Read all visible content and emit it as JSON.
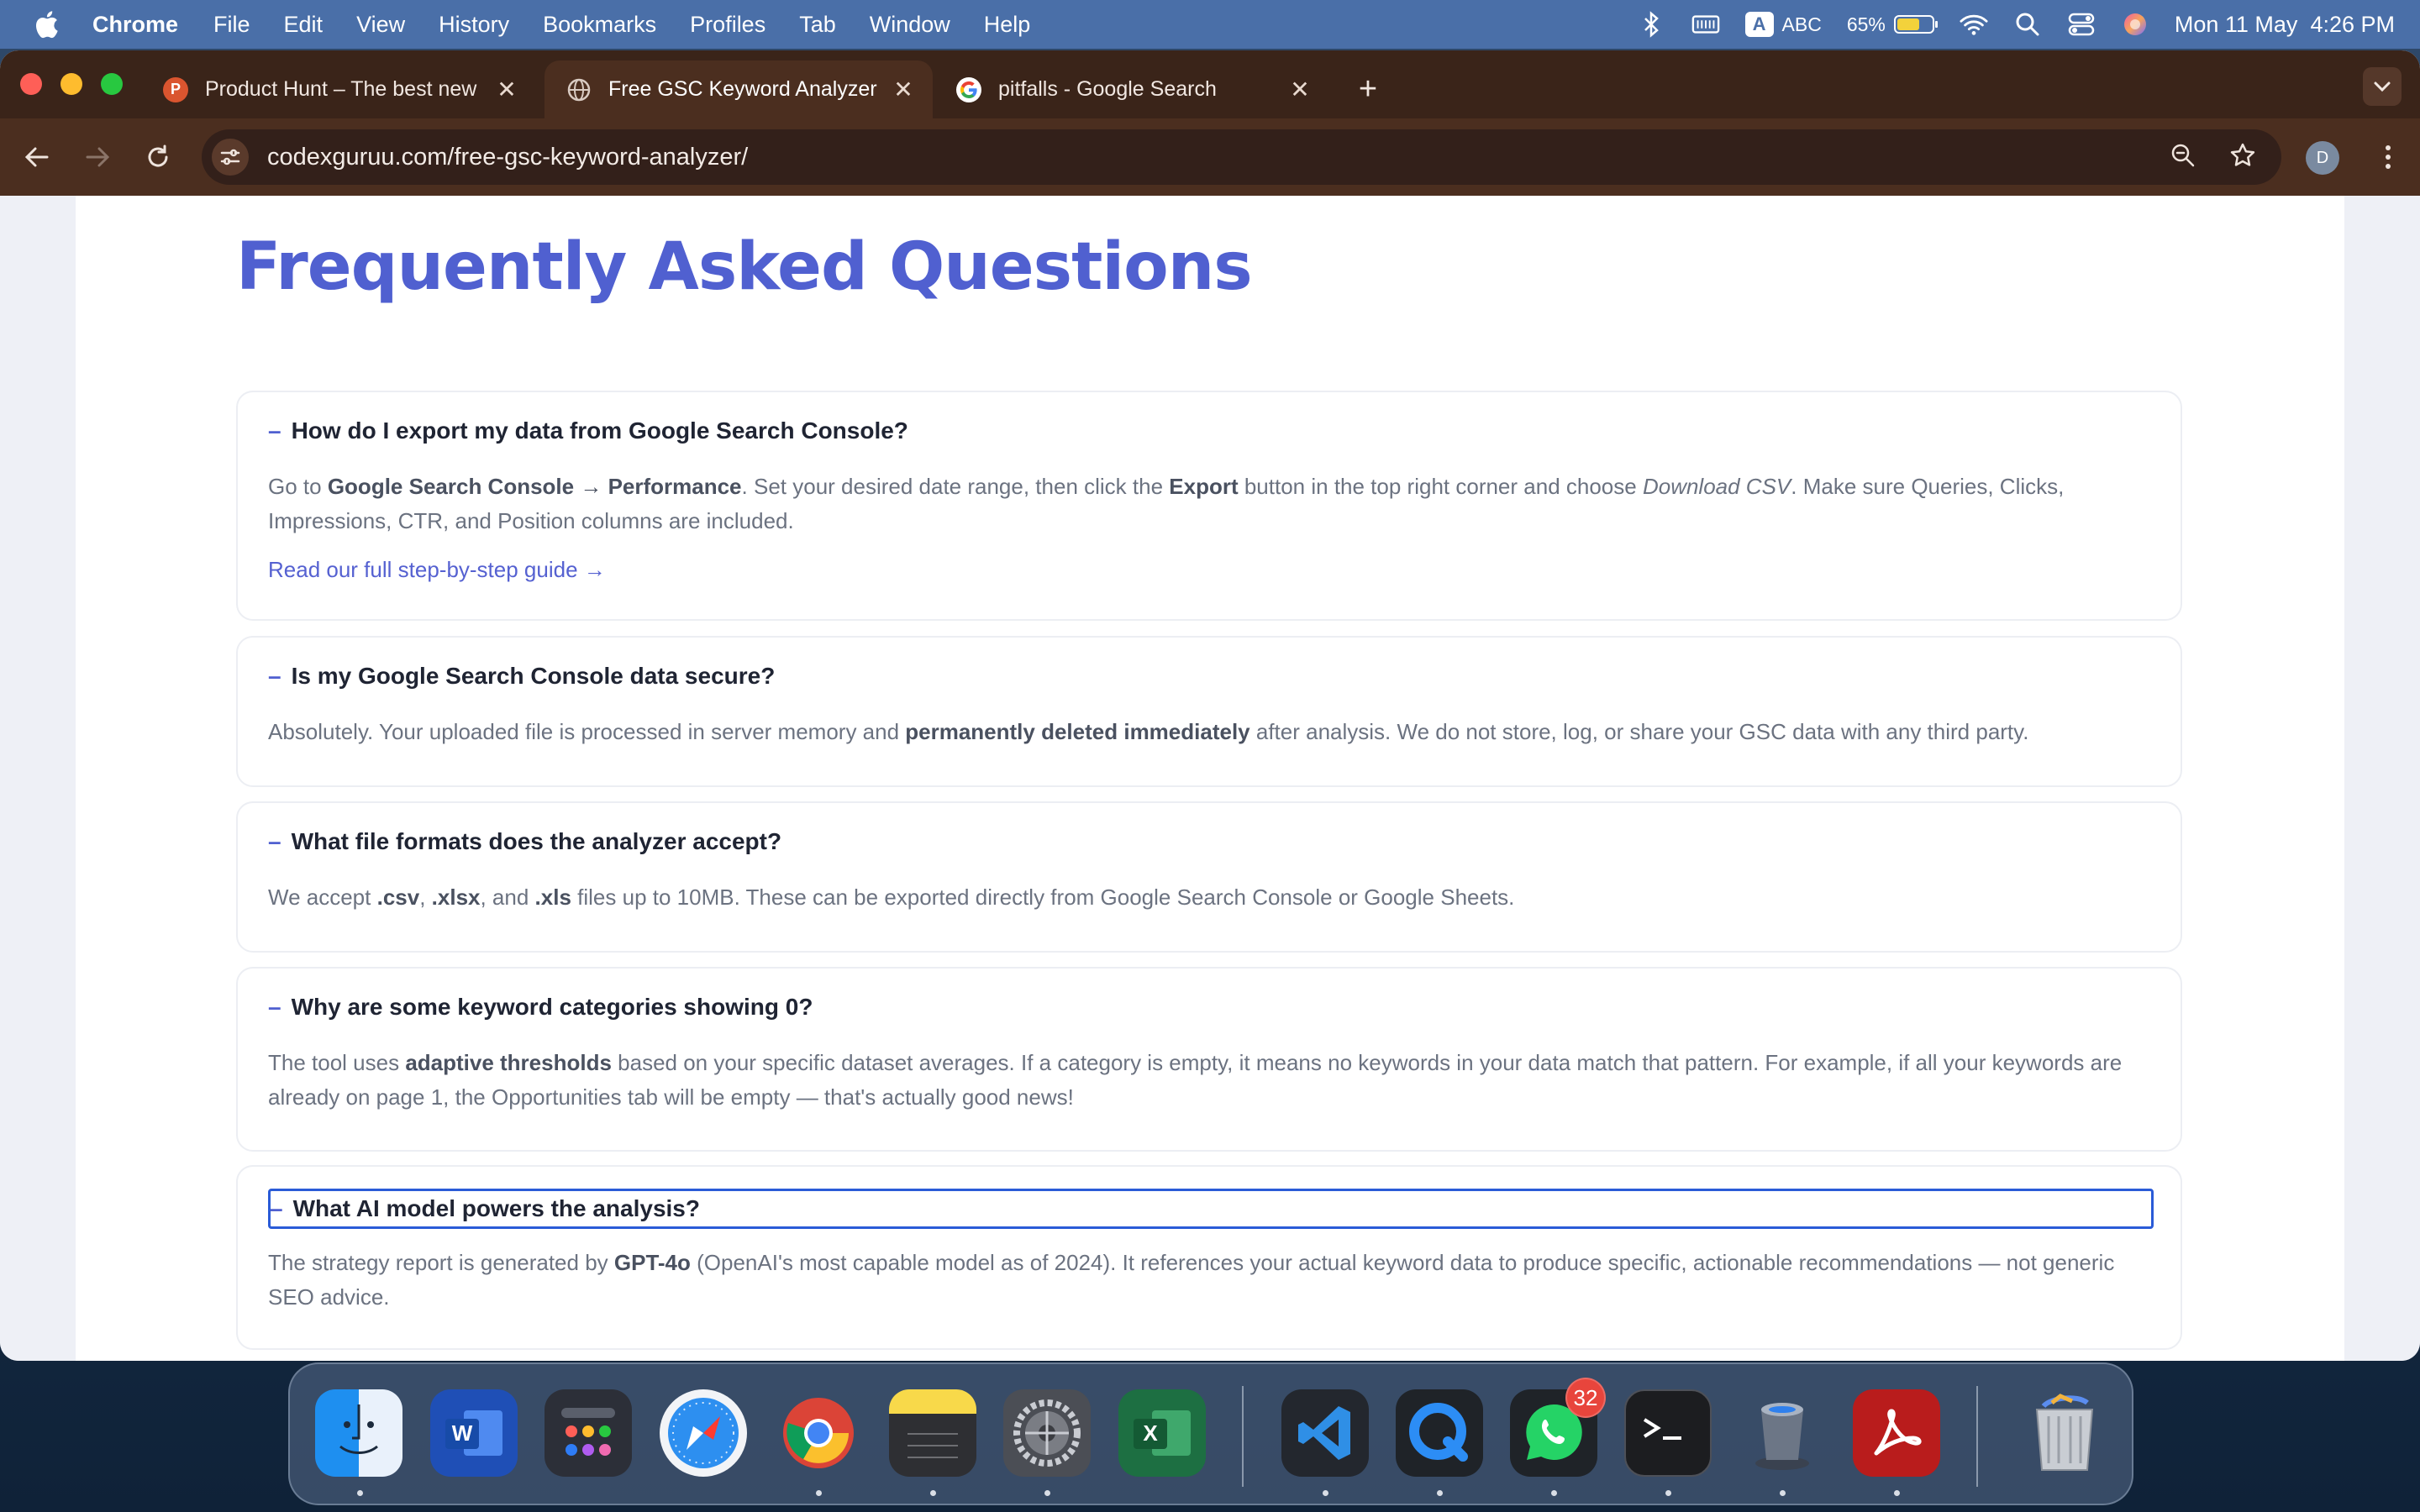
{
  "menubar": {
    "app_name": "Chrome",
    "items": [
      "File",
      "Edit",
      "View",
      "History",
      "Bookmarks",
      "Profiles",
      "Tab",
      "Window",
      "Help"
    ],
    "input_source": "A",
    "input_label": "ABC",
    "battery_percent": "65%",
    "battery_level": 0.65,
    "datetime": "Mon 11 May  4:26 PM"
  },
  "browser": {
    "tabs": [
      {
        "title": "Product Hunt – The best new products in tech.",
        "favicon": "P",
        "favicon_color": "#da552f",
        "active": false
      },
      {
        "title": "Free GSC Keyword Analyzer | CodexGuruu",
        "favicon": "globe-icon",
        "active": true
      },
      {
        "title": "pitfalls - Google Search",
        "favicon": "google-icon",
        "active": false
      }
    ],
    "url": "codexguruu.com/free-gsc-keyword-analyzer/",
    "profile_initial": "D"
  },
  "faq": {
    "title": "Frequently Asked Questions",
    "dash": "–",
    "items": [
      {
        "question": "How do I export my data from Google Search Console?",
        "answer_parts": {
          "p1": "Go to ",
          "b1": "Google Search Console → Performance",
          "p2": ". Set your desired date range, then click the ",
          "b2": "Export",
          "p3": " button in the top right corner and choose ",
          "i1": "Download CSV",
          "p4": ". Make sure Queries, Clicks, Impressions, CTR, and Position columns are included."
        },
        "link": "Read our full step-by-step guide →"
      },
      {
        "question": "Is my Google Search Console data secure?",
        "answer_parts": {
          "p1": "Absolutely. Your uploaded file is processed in server memory and ",
          "b1": "permanently deleted immediately",
          "p2": " after analysis. We do not store, log, or share your GSC data with any third party."
        }
      },
      {
        "question": "What file formats does the analyzer accept?",
        "answer_parts": {
          "p1": "We accept ",
          "b1": ".csv",
          "p2": ", ",
          "b2": ".xlsx",
          "p3": ", and ",
          "b3": ".xls",
          "p4": " files up to 10MB. These can be exported directly from Google Search Console or Google Sheets."
        }
      },
      {
        "question": "Why are some keyword categories showing 0?",
        "answer_parts": {
          "p1": "The tool uses ",
          "b1": "adaptive thresholds",
          "p2": " based on your specific dataset averages. If a category is empty, it means no keywords in your data match that pattern. For example, if all your keywords are already on page 1, the Opportunities tab will be empty — that's actually good news!"
        }
      },
      {
        "question": "What AI model powers the analysis?",
        "answer_parts": {
          "p1": "The strategy report is generated by ",
          "b1": "GPT-4o",
          "p2": " (OpenAI's most capable model as of 2024). It references your actual keyword data to produce specific, actionable recommendations — not generic SEO advice."
        }
      }
    ]
  },
  "dock": {
    "apps": [
      "Finder",
      "Microsoft Word",
      "Launchpad",
      "Safari",
      "Google Chrome",
      "Notes",
      "System Settings",
      "Microsoft Excel",
      "Visual Studio Code",
      "QuickTime Player",
      "WhatsApp",
      "Terminal",
      "Migration Assistant",
      "Adobe Acrobat",
      "Trash"
    ],
    "whatsapp_badge": "32"
  }
}
